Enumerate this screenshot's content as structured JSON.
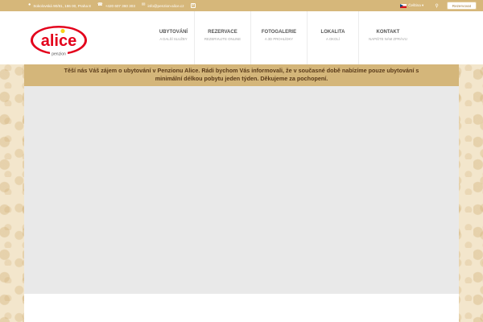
{
  "topbar": {
    "address": "Sokolovská 90/81, 186 00, Praha 8",
    "phone": "+420 607 360 303",
    "email": "info@penzion-alice.cz",
    "language": "Čeština",
    "reserve_label": "Rezervovat"
  },
  "logo": {
    "name": "alice",
    "tagline": "penzion"
  },
  "nav": {
    "items": [
      {
        "title": "UBYTOVÁNÍ",
        "subtitle": "A DALŠÍ SLUŽBY"
      },
      {
        "title": "REZERVACE",
        "subtitle": "REZERVUJTE ONLINE"
      },
      {
        "title": "FOTOGALERIE",
        "subtitle": "A 3D PROHLÍDKY"
      },
      {
        "title": "LOKALITA",
        "subtitle": "A OKOLÍ"
      },
      {
        "title": "KONTAKT",
        "subtitle": "NAPIŠTE NÁM ZPRÁVU"
      }
    ]
  },
  "notice": {
    "line1": "Těší nás Váš zájem o ubytování v Penzionu Alice. Rádi bychom Vás informovali, že v současné době nabízíme pouze ubytování s",
    "line2": "minimální délkou pobytu jeden týden. Děkujeme za pochopení."
  },
  "colors": {
    "topbar": "#d6b77a",
    "notice": "#d4b67a",
    "logo_red": "#e3001b",
    "logo_yellow": "#f6d21b",
    "hero_placeholder": "#e9e9e9"
  }
}
